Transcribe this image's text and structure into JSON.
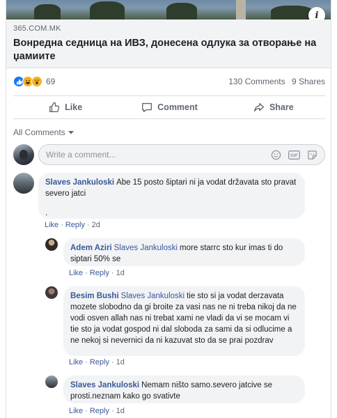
{
  "link": {
    "domain": "365.COM.MK",
    "title": "Вонредна седница на ИВЗ, донесена одлука за отворање на џамиите",
    "info_icon": "info-icon"
  },
  "stats": {
    "reaction_icons": [
      "like",
      "haha",
      "wow"
    ],
    "reaction_count": "69",
    "comments": "130 Comments",
    "shares": "9 Shares"
  },
  "actions": {
    "like": "Like",
    "comment": "Comment",
    "share": "Share"
  },
  "filter": {
    "label": "All Comments"
  },
  "composer": {
    "placeholder": "Write a comment..."
  },
  "comments": [
    {
      "author": "Slaves Jankuloski",
      "mention": "",
      "text": "Abe 15 posto šiptari ni ja vodat državata sto pravat severo jatci",
      "extra": ".",
      "like": "Like",
      "reply": "Reply",
      "time": "2d"
    },
    {
      "author": "Adem Aziri",
      "mention": "Slaves Jankuloski",
      "text": "more starrc sto kur imas ti do siptari 50% se",
      "like": "Like",
      "reply": "Reply",
      "time": "1d"
    },
    {
      "author": "Besim Bushi",
      "mention": "Slaves Jankuloski",
      "text": "tie sto si ja vodat derzavata mozete slobodno da gi broite za vasi nas ne ni treba nikoj da ne vodi osven allah nas ni trebat xami ne vladi da vi se mocam vi tie sto ja vodat gospod ni dal sloboda za sami da si odlucime a ne nekoj si nevernici da ni kazuvat sto da se prai pozdrav",
      "like": "Like",
      "reply": "Reply",
      "time": "1d"
    },
    {
      "author": "Slaves Jankuloski",
      "mention": "",
      "text": "Nemam ništo samo.severo jatcive se prosti.neznam kako go svativte",
      "like": "Like",
      "reply": "Reply",
      "time": "1d"
    }
  ],
  "colors": {
    "link_blue": "#385898",
    "like_blue": "#1877f2",
    "reaction_yellow": "#f7b125",
    "bubble_bg": "#f2f3f5",
    "meta_grey": "#606770"
  }
}
